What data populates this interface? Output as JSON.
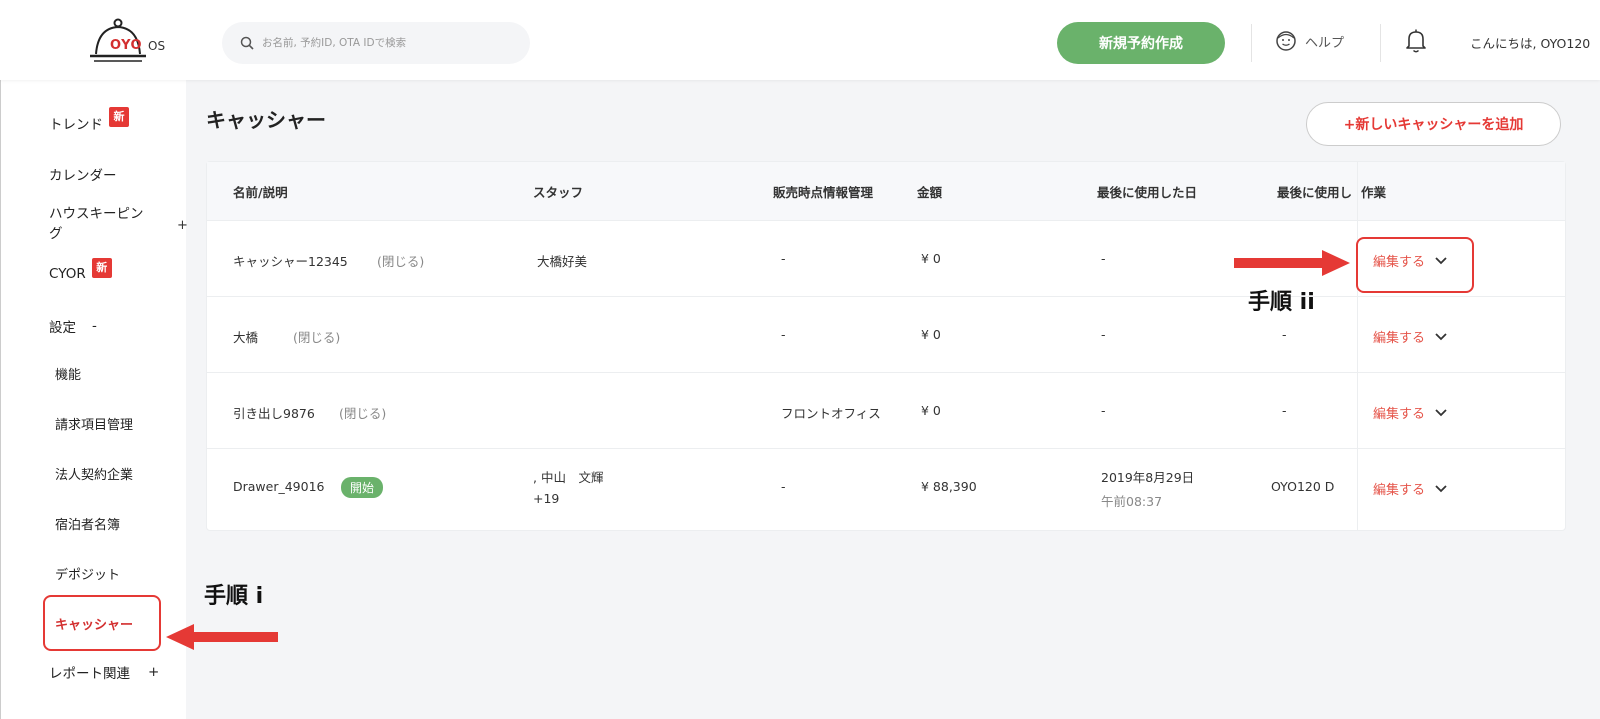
{
  "header": {
    "logo_text": "OYO",
    "logo_suffix": "OS",
    "search_placeholder": "お名前, 予約ID, OTA IDで検索",
    "new_booking_label": "新規予約作成",
    "help_label": "ヘルプ",
    "greeting": "こんにちは, OYO120"
  },
  "sidebar": {
    "items": [
      {
        "label": "トレンド",
        "badge": "新"
      },
      {
        "label": "カレンダー"
      },
      {
        "label": "ハウスキーピン\nグ",
        "toggle": "+"
      },
      {
        "label": "CYOR",
        "badge": "新"
      },
      {
        "label": "設定",
        "toggle": "-"
      },
      {
        "label": "機能"
      },
      {
        "label": "請求項目管理"
      },
      {
        "label": "法人契約企業"
      },
      {
        "label": "宿泊者名簿"
      },
      {
        "label": "デポジット"
      },
      {
        "label": "キャッシャー"
      },
      {
        "label": "レポート関連",
        "toggle": "+"
      }
    ]
  },
  "main": {
    "title": "キャッシャー",
    "add_button": "+新しいキャッシャーを追加",
    "columns": [
      "名前/説明",
      "スタッフ",
      "販売時点情報管理",
      "金額",
      "最後に使用した日",
      "最後に使用し",
      "作業"
    ],
    "rows": [
      {
        "name": "キャッシャー12345",
        "status": "(閉じる)",
        "staff": "大橋好美",
        "staff2": "",
        "pos": "-",
        "amount": "¥ 0",
        "last_date": "-",
        "last_time": "",
        "last_user": "",
        "action": "編集する"
      },
      {
        "name": "大橋",
        "status": "(閉じる)",
        "staff": "",
        "staff2": "",
        "pos": "-",
        "amount": "¥ 0",
        "last_date": "-",
        "last_time": "",
        "last_user": "-",
        "action": "編集する"
      },
      {
        "name": "引き出し9876",
        "status": "(閉じる)",
        "staff": "",
        "staff2": "",
        "pos": "フロントオフィス",
        "amount": "¥ 0",
        "last_date": "-",
        "last_time": "",
        "last_user": "-",
        "action": "編集する"
      },
      {
        "name": "Drawer_49016",
        "status": "開始",
        "staff": ", 中山　文輝",
        "staff2": "+19",
        "pos": "-",
        "amount": "¥ 88,390",
        "last_date": "2019年8月29日",
        "last_time": "午前08:37",
        "last_user": "OYO120 D",
        "action": "編集する"
      }
    ]
  },
  "annotations": {
    "step_i": "手順 i",
    "step_ii": "手順 ii",
    "arrow_color": "#e53935"
  }
}
